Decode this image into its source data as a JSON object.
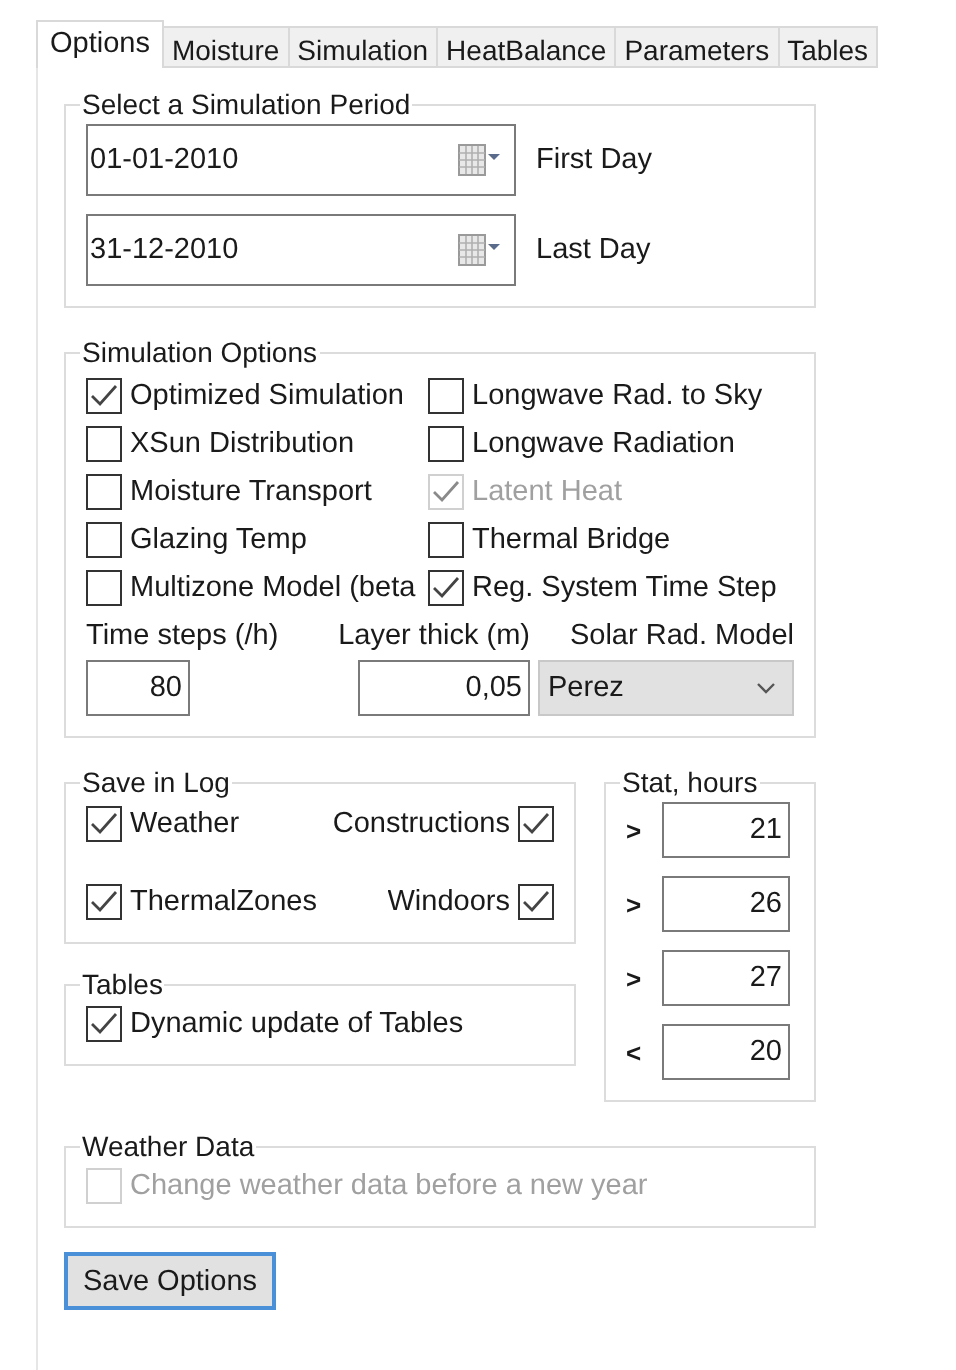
{
  "tabs": [
    {
      "label": "Options",
      "selected": true
    },
    {
      "label": "Moisture",
      "selected": false
    },
    {
      "label": "Simulation",
      "selected": false
    },
    {
      "label": "HeatBalance",
      "selected": false
    },
    {
      "label": "Parameters",
      "selected": false
    },
    {
      "label": "Tables",
      "selected": false
    }
  ],
  "simulation_period": {
    "title": "Select a Simulation Period",
    "dates": [
      {
        "value": "01-01-2010",
        "label": "First Day"
      },
      {
        "value": "31-12-2010",
        "label": "Last Day"
      }
    ]
  },
  "simulation_options": {
    "title": "Simulation Options",
    "options": [
      {
        "label": "Optimized Simulation",
        "checked": true,
        "disabled": false
      },
      {
        "label": "Longwave Rad. to Sky",
        "checked": false,
        "disabled": false
      },
      {
        "label": "XSun Distribution",
        "checked": false,
        "disabled": false
      },
      {
        "label": "Longwave Radiation",
        "checked": false,
        "disabled": false
      },
      {
        "label": "Moisture Transport",
        "checked": false,
        "disabled": false
      },
      {
        "label": "Latent Heat",
        "checked": true,
        "disabled": true
      },
      {
        "label": "Glazing Temp",
        "checked": false,
        "disabled": false
      },
      {
        "label": "Thermal Bridge",
        "checked": false,
        "disabled": false
      },
      {
        "label": "Multizone Model (beta",
        "checked": false,
        "disabled": false
      },
      {
        "label": "Reg. System Time Step",
        "checked": true,
        "disabled": false
      }
    ],
    "time_steps": {
      "label": "Time steps (/h)",
      "value": "80"
    },
    "layer_thick": {
      "label": "Layer thick (m)",
      "value": "0,05"
    },
    "solar_model": {
      "label": "Solar Rad. Model",
      "value": "Perez"
    }
  },
  "save_in_log": {
    "title": "Save in Log",
    "items": [
      {
        "label": "Weather",
        "checked": true
      },
      {
        "label": "Constructions",
        "checked": true
      },
      {
        "label": "ThermalZones",
        "checked": true
      },
      {
        "label": "Windoors",
        "checked": true
      }
    ]
  },
  "tables": {
    "title": "Tables",
    "option": {
      "label": "Dynamic update of Tables",
      "checked": true
    }
  },
  "stat_hours": {
    "title": "Stat, hours",
    "rows": [
      {
        "operator": ">",
        "value": "21"
      },
      {
        "operator": ">",
        "value": "26"
      },
      {
        "operator": ">",
        "value": "27"
      },
      {
        "operator": "<",
        "value": "20"
      }
    ]
  },
  "weather_data": {
    "title": "Weather Data",
    "option": {
      "label": "Change weather data before a new year",
      "checked": false,
      "disabled": true
    }
  },
  "save_button": "Save Options"
}
